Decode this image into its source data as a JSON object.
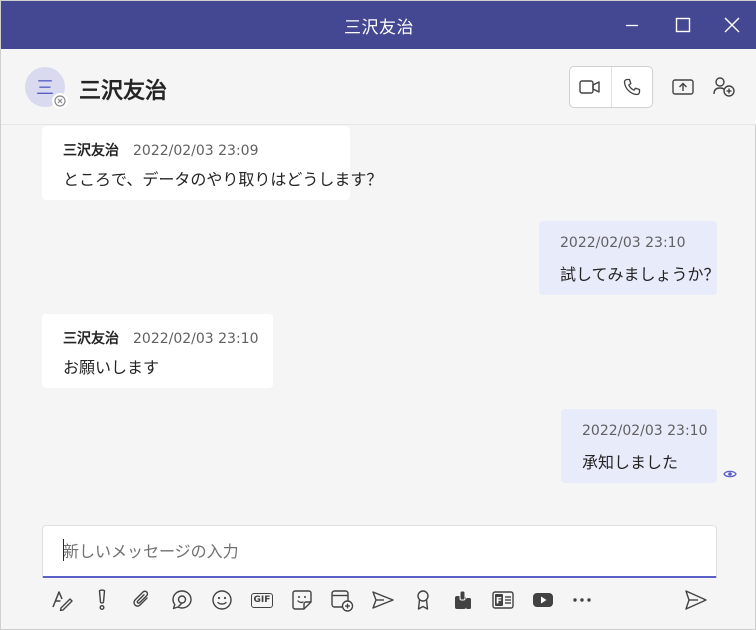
{
  "window": {
    "title": "三沢友治",
    "accent_color": "#444791"
  },
  "header": {
    "avatar_initial": "三",
    "contact_name": "三沢友治",
    "presence": "offline",
    "buttons": [
      "video-call",
      "audio-call",
      "share-screen",
      "add-people"
    ]
  },
  "messages": [
    {
      "direction": "incoming",
      "sender": "三沢友治",
      "time": "2022/02/03 23:09",
      "text": "ところで、データのやり取りはどうします？"
    },
    {
      "direction": "outgoing",
      "sender": "",
      "time": "2022/02/03 23:10",
      "text": "試してみましょうか？"
    },
    {
      "direction": "incoming",
      "sender": "三沢友治",
      "time": "2022/02/03 23:10",
      "text": "お願いします"
    },
    {
      "direction": "outgoing",
      "sender": "",
      "time": "2022/02/03 23:10",
      "text": "承知しました"
    }
  ],
  "read_receipt_icon": "eye-icon",
  "compose": {
    "placeholder": "新しいメッセージの入力",
    "value": ""
  },
  "toolbar": {
    "gif_label": "GIF",
    "icons": [
      "format-icon",
      "important-icon",
      "attach-icon",
      "loop-icon",
      "emoji-icon",
      "gif-icon",
      "sticker-icon",
      "schedule-meeting-icon",
      "stream-icon",
      "praise-icon",
      "apps-icon",
      "forms-icon",
      "youtube-icon",
      "more-icon",
      "send-icon"
    ]
  }
}
